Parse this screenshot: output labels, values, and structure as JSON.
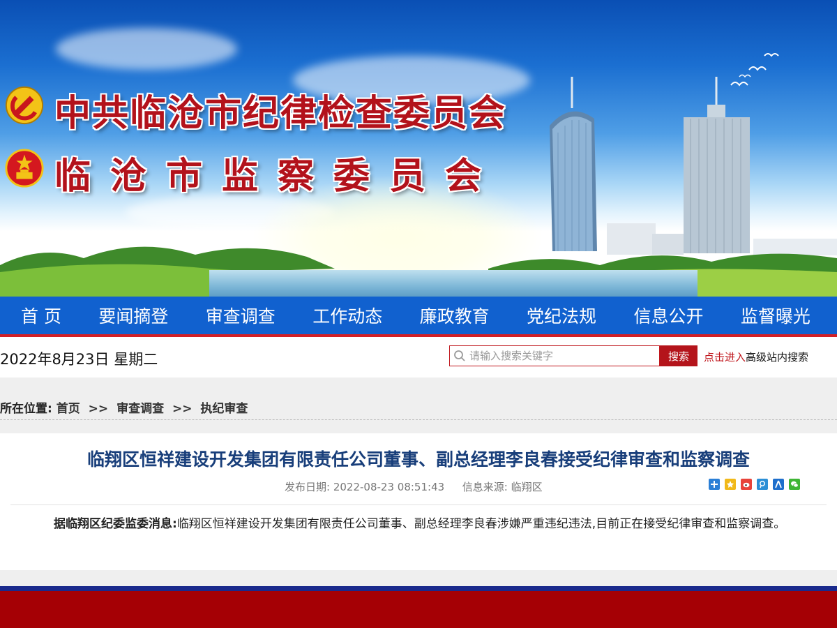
{
  "banner": {
    "title_line1": "中共临沧市纪律检查委员会",
    "title_line2": "临沧市监察委员会"
  },
  "nav": {
    "items": [
      "首 页",
      "要闻摘登",
      "审查调查",
      "工作动态",
      "廉政教育",
      "党纪法规",
      "信息公开",
      "监督曝光"
    ]
  },
  "toolbar": {
    "date": "2022年8月23日 星期二",
    "search_placeholder": "请输入搜索关键字",
    "search_button": "搜索",
    "advanced_link": "点击进入",
    "advanced_text": "高级站内搜索"
  },
  "breadcrumb": {
    "prefix": "所在位置:",
    "items": [
      "首页",
      "审查调查",
      "执纪审查"
    ],
    "separator": ">>"
  },
  "article": {
    "title": "临翔区恒祥建设开发集团有限责任公司董事、副总经理李良春接受纪律审查和监察调查",
    "date_label": "发布日期:",
    "date_value": "2022-08-23 08:51:43",
    "source_label": "信息来源:",
    "source_value": "临翔区",
    "body_lead": "据临翔区纪委监委消息:",
    "body_text": "临翔区恒祥建设开发集团有限责任公司董事、副总经理李良春涉嫌严重违纪违法,目前正在接受纪律审查和监察调查。"
  },
  "share_icons": [
    "plus-share-icon",
    "qzone-icon",
    "weibo-icon",
    "tencent-weibo-icon",
    "renren-icon",
    "wechat-icon"
  ],
  "colors": {
    "nav_bg": "#1161cf",
    "accent_red": "#c0161c",
    "title_blue": "#183e7a",
    "footer_red": "#a50005",
    "footer_navy": "#1a2a8c"
  }
}
